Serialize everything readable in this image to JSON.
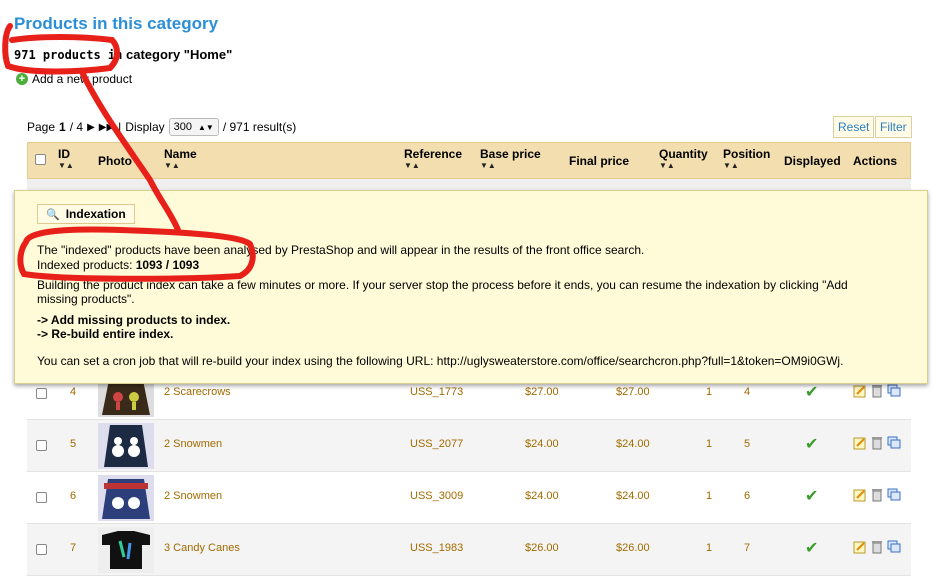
{
  "header": {
    "title": "Products in this category",
    "count_num": "971 products in",
    "count_rest": "category \"Home\"",
    "add_label": "Add a new product"
  },
  "pagination": {
    "page_label": "Page",
    "current": "1",
    "total": "/ 4",
    "display_label": "Display",
    "per_page": "300",
    "results": "/ 971 result(s)"
  },
  "buttons": {
    "reset": "Reset",
    "filter": "Filter"
  },
  "columns": {
    "id": "ID",
    "photo": "Photo",
    "name": "Name",
    "reference": "Reference",
    "base_price": "Base price",
    "final_price": "Final price",
    "quantity": "Quantity",
    "position": "Position",
    "displayed": "Displayed",
    "actions": "Actions"
  },
  "popup": {
    "legend": "Indexation",
    "line1": "The \"indexed\" products have been analysed by PrestaShop and will appear in the results of the front office search.",
    "indexed_label": "Indexed products:",
    "indexed_value": "1093 / 1093",
    "line3": "Building the product index can take a few minutes or more. If your server stop the process before it ends, you can resume the indexation by clicking \"Add",
    "line4": "missing products\".",
    "arrow": "->",
    "link_add": "Add missing products to index.",
    "link_rebuild": "Re-build entire index.",
    "cron": "You can set a cron job that will re-build your index using the following URL: http://uglysweaterstore.com/office/searchcron.php?full=1&token=OM9i0GWj."
  },
  "rows": [
    {
      "id": "4",
      "name": "2 Scarecrows",
      "reference": "USS_1773",
      "base_price": "$27.00",
      "final_price": "$27.00",
      "quantity": "1",
      "position": "4"
    },
    {
      "id": "5",
      "name": "2 Snowmen",
      "reference": "USS_2077",
      "base_price": "$24.00",
      "final_price": "$24.00",
      "quantity": "1",
      "position": "5"
    },
    {
      "id": "6",
      "name": "2 Snowmen",
      "reference": "USS_3009",
      "base_price": "$24.00",
      "final_price": "$24.00",
      "quantity": "1",
      "position": "6"
    },
    {
      "id": "7",
      "name": "3 Candy Canes",
      "reference": "USS_1983",
      "base_price": "$26.00",
      "final_price": "$26.00",
      "quantity": "1",
      "position": "7"
    }
  ],
  "colors": {
    "title": "#2a8fd6",
    "header_bg": "#f2deae",
    "popup_bg": "#fffbd8",
    "annotation": "#e8201a",
    "price": "#a06b00"
  },
  "icons": [
    "add-icon",
    "next-page-icon",
    "last-page-icon",
    "magnifier-icon",
    "check-icon",
    "edit-icon",
    "delete-icon",
    "duplicate-icon"
  ]
}
